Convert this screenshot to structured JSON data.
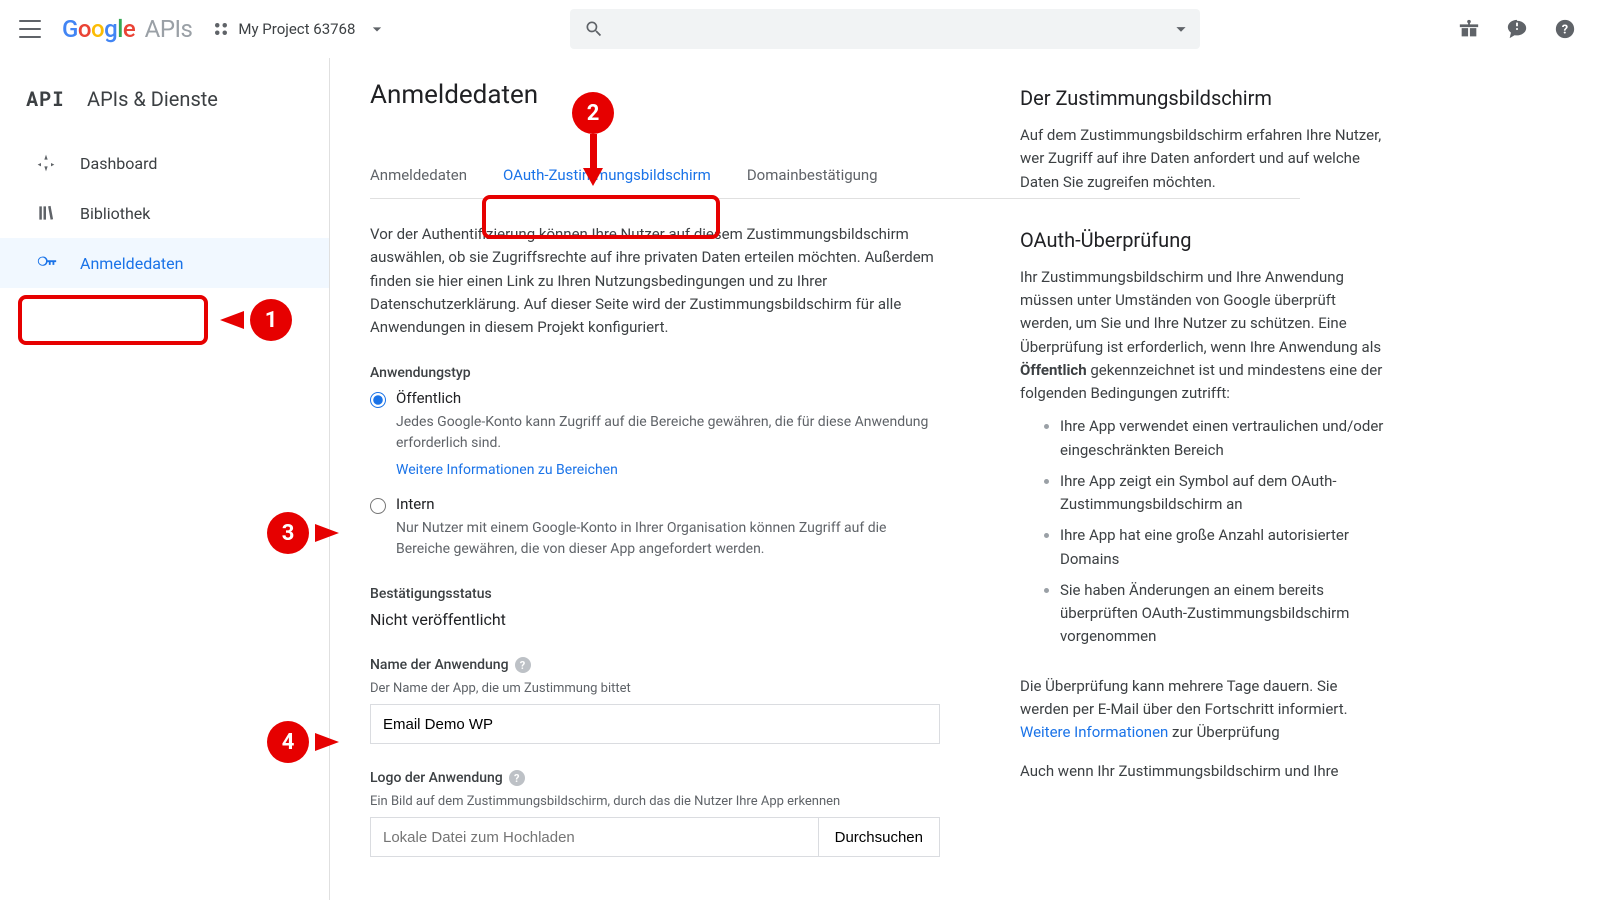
{
  "header": {
    "project": "My Project 63768"
  },
  "sidebar": {
    "title": "APIs & Dienste",
    "api_badge": "API",
    "items": [
      {
        "label": "Dashboard"
      },
      {
        "label": "Bibliothek"
      },
      {
        "label": "Anmeldedaten"
      }
    ]
  },
  "page": {
    "title": "Anmeldedaten"
  },
  "tabs": {
    "credentials": "Anmeldedaten",
    "consent": "OAuth-Zustimmungsbildschirm",
    "domain": "Domainbestätigung"
  },
  "intro": "Vor der Authentifizierung können Ihre Nutzer auf diesem Zustimmungsbildschirm auswählen, ob sie Zugriffsrechte auf ihre privaten Daten erteilen möchten. Außerdem finden sie hier einen Link zu Ihren Nutzungsbedingungen und zu Ihrer Datenschutzerklärung. Auf dieser Seite wird der Zustimmungsbildschirm für alle Anwendungen in diesem Projekt konfiguriert.",
  "app_type": {
    "heading": "Anwendungstyp",
    "public": "Öffentlich",
    "public_desc": "Jedes Google-Konto kann Zugriff auf die Bereiche gewähren, die für diese Anwendung erforderlich sind.",
    "public_link": "Weitere Informationen zu Bereichen",
    "internal": "Intern",
    "internal_desc": "Nur Nutzer mit einem Google-Konto in Ihrer Organisation können Zugriff auf die Bereiche gewähren, die von dieser App angefordert werden."
  },
  "status": {
    "heading": "Bestätigungsstatus",
    "value": "Nicht veröffentlicht"
  },
  "app_name": {
    "heading": "Name der Anwendung",
    "help": "Der Name der App, die um Zustimmung bittet",
    "value": "Email Demo WP"
  },
  "app_logo": {
    "heading": "Logo der Anwendung",
    "help": "Ein Bild auf dem Zustimmungsbildschirm, durch das die Nutzer Ihre App erkennen",
    "placeholder": "Lokale Datei zum Hochladen",
    "browse": "Durchsuchen"
  },
  "right": {
    "h1": "Der Zustimmungsbildschirm",
    "p1": "Auf dem Zustimmungsbildschirm erfahren Ihre Nutzer, wer Zugriff auf ihre Daten anfordert und auf welche Daten Sie zugreifen möchten.",
    "h2": "OAuth-Überprüfung",
    "p2a": "Ihr Zustimmungsbildschirm und Ihre Anwendung müssen unter Umständen von Google überprüft werden, um Sie und Ihre Nutzer zu schützen. Eine Überprüfung ist erforderlich, wenn Ihre Anwendung als ",
    "p2b": "Öffentlich",
    "p2c": " gekennzeichnet ist und mindestens eine der folgenden Bedingungen zutrifft:",
    "li1": "Ihre App verwendet einen vertraulichen und/oder eingeschränkten Bereich",
    "li2": "Ihre App zeigt ein Symbol auf dem OAuth-Zustimmungsbildschirm an",
    "li3": "Ihre App hat eine große Anzahl autorisierter Domains",
    "li4": "Sie haben Änderungen an einem bereits überprüften OAuth-Zustimmungsbildschirm vorgenommen",
    "p3a": "Die Überprüfung kann mehrere Tage dauern. Sie werden per E-Mail über den Fortschritt informiert. ",
    "p3link": "Weitere Informationen",
    "p3b": " zur Überprüfung",
    "p4": "Auch wenn Ihr Zustimmungsbildschirm und Ihre"
  }
}
